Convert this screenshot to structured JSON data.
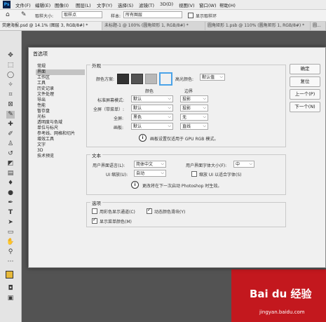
{
  "app": {
    "logo": "Ps"
  },
  "menu": [
    "文件(F)",
    "编辑(E)",
    "图像(I)",
    "图层(L)",
    "文字(Y)",
    "选择(S)",
    "滤镜(T)",
    "3D(D)",
    "视图(V)",
    "窗口(W)",
    "帮助(H)"
  ],
  "options": {
    "size_label": "取样大小:",
    "size_value": "取样点",
    "sample_label": "样本:",
    "sample_value": "所有图层",
    "show_ring_label": "显示取样环"
  },
  "tabs": [
    "荧建海报.psd @ 14.1% (图层 3, RGB/8#) *",
    "未标题-1 @ 100% (圆角矩形 1, RGB/8#) *",
    "圆角矩形 1.psb @ 110% (圆角矩形 1, RGB/8#) *",
    "圆..."
  ],
  "dialog": {
    "title": "首选项",
    "categories": [
      "常规",
      "界面",
      "工作区",
      "工具",
      "历史记录",
      "文件处理",
      "导出",
      "性能",
      "暂存盘",
      "光标",
      "透明度与色域",
      "单位与标尺",
      "参考线、网格和切片",
      "增效工具",
      "文字",
      "3D",
      "技术预览"
    ],
    "selected_category": "界面",
    "buttons": [
      "确定",
      "复位",
      "上一个(P)",
      "下一个(N)"
    ],
    "appearance": {
      "title": "外观",
      "color_scheme_label": "颜色方案:",
      "highlight_label": "高光颜色:",
      "highlight_value": "默认值",
      "col_color": "颜色",
      "col_border": "边界",
      "rows": [
        {
          "label": "标准屏幕模式:",
          "color": "默认",
          "border": "投影"
        },
        {
          "label": "全屏（带菜单）:",
          "color": "默认",
          "border": "投影"
        },
        {
          "label": "全屏:",
          "color": "黑色",
          "border": "无"
        },
        {
          "label": "画板:",
          "color": "默认",
          "border": "直线"
        }
      ],
      "note": "画板设置仅适用于 GPU RGB 模式。",
      "swatches": [
        "#323232",
        "#535353",
        "#b8b8b8",
        "#f0f0f0"
      ]
    },
    "text": {
      "title": "文本",
      "ui_lang_label": "用户界面语言(L):",
      "ui_lang_value": "简体中文",
      "ui_font_label": "用户界面字体大小(F):",
      "ui_font_value": "中",
      "ui_scale_label": "UI 缩放(U):",
      "ui_scale_value": "自动",
      "scale_fit_label": "缩放 UI 以适合字体(S)",
      "note": "更改将在下一次启动 Photoshop 时生效。"
    },
    "options": {
      "title": "选项",
      "channels_color_label": "用彩色显示通道(C)",
      "dynamic_sliders_label": "动态颜色滑块(Y)",
      "menu_colors_label": "显示菜单颜色(M)"
    }
  },
  "watermark": {
    "brand": "Bai du 经验",
    "url": "jingyan.baidu.com"
  }
}
